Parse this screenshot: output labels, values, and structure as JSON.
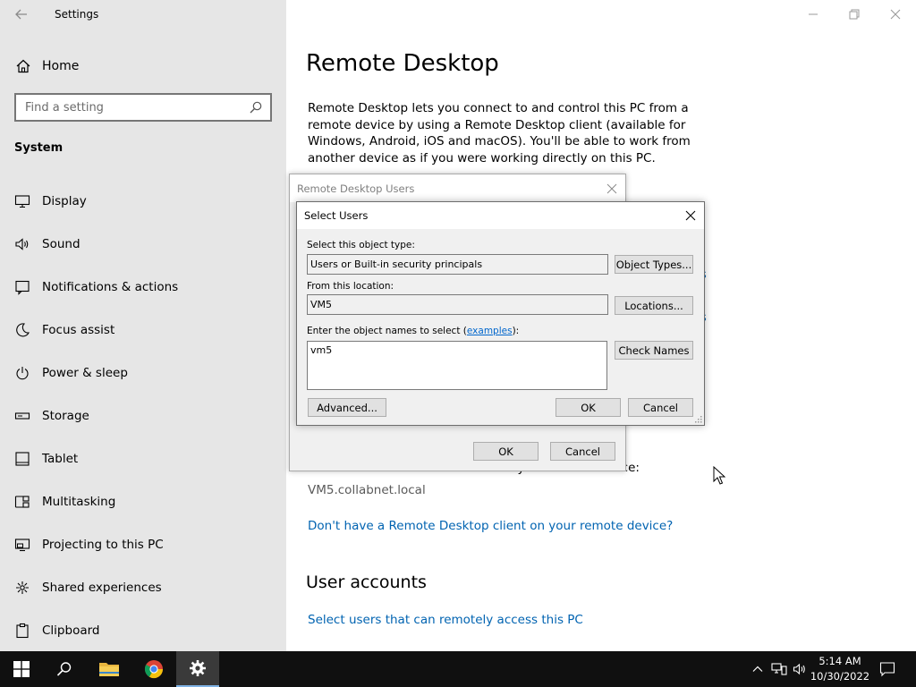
{
  "app": {
    "title": "Settings"
  },
  "sidebar": {
    "home_label": "Home",
    "search_placeholder": "Find a setting",
    "section": "System",
    "items": [
      {
        "label": "Display",
        "icon": "monitor-icon"
      },
      {
        "label": "Sound",
        "icon": "speaker-icon"
      },
      {
        "label": "Notifications & actions",
        "icon": "notifications-icon"
      },
      {
        "label": "Focus assist",
        "icon": "moon-icon"
      },
      {
        "label": "Power & sleep",
        "icon": "power-icon"
      },
      {
        "label": "Storage",
        "icon": "storage-icon"
      },
      {
        "label": "Tablet",
        "icon": "tablet-icon"
      },
      {
        "label": "Multitasking",
        "icon": "multitasking-icon"
      },
      {
        "label": "Projecting to this PC",
        "icon": "projecting-icon"
      },
      {
        "label": "Shared experiences",
        "icon": "shared-experiences-icon"
      },
      {
        "label": "Clipboard",
        "icon": "clipboard-icon"
      }
    ]
  },
  "main": {
    "title": "Remote Desktop",
    "description": "Remote Desktop lets you connect to and control this PC from a remote device by using a Remote Desktop client (available for Windows, Android, iOS and macOS). You'll be able to work from another device as if you were working directly on this PC.",
    "link_fragment_1": "s",
    "link_fragment_2": "s",
    "device_hint": "Use this PC name to connect from your remote device:",
    "pc_name": "VM5.collabnet.local",
    "client_link": "Don't have a Remote Desktop client on your remote device?",
    "accounts_heading": "User accounts",
    "users_link": "Select users that can remotely access this PC"
  },
  "rdu_dialog": {
    "title": "Remote Desktop Users",
    "ok_label": "OK",
    "cancel_label": "Cancel"
  },
  "select_users": {
    "title": "Select Users",
    "object_type_label": "Select this object type:",
    "object_type_value": "Users or Built-in security principals",
    "object_types_button": "Object Types...",
    "location_label": "From this location:",
    "location_value": "VM5",
    "locations_button": "Locations...",
    "names_label_prefix": "Enter the object names to select (",
    "names_label_link": "examples",
    "names_label_suffix": "):",
    "names_value": "vm5",
    "check_names_button": "Check Names",
    "advanced_button": "Advanced...",
    "ok_button": "OK",
    "cancel_button": "Cancel"
  },
  "taskbar": {
    "time": "5:14 AM",
    "date": "10/30/2022"
  },
  "colors": {
    "sidebar_bg": "#e6e6e6",
    "link": "#0063b1",
    "taskbar": "#101010",
    "accent": "#7fb2e5"
  }
}
